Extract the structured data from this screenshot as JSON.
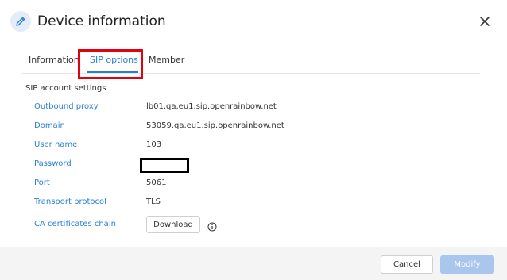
{
  "dialog": {
    "title": "Device information",
    "icon": "pencil-icon",
    "close_icon": "close-icon"
  },
  "tabs": [
    {
      "label": "Information",
      "active": false
    },
    {
      "label": "SIP options",
      "active": true
    },
    {
      "label": "Member",
      "active": false
    }
  ],
  "section": {
    "title": "SIP account settings",
    "rows": [
      {
        "label": "Outbound proxy",
        "value": "lb01.qa.eu1.sip.openrainbow.net"
      },
      {
        "label": "Domain",
        "value": "53059.qa.eu1.sip.openrainbow.net"
      },
      {
        "label": "User name",
        "value": "103"
      },
      {
        "label": "Password",
        "value": ""
      },
      {
        "label": "Port",
        "value": "5061"
      },
      {
        "label": "Transport protocol",
        "value": "TLS"
      },
      {
        "label": "CA certificates chain",
        "value": ""
      }
    ],
    "download_label": "Download",
    "info_icon": "info-icon"
  },
  "footer": {
    "cancel_label": "Cancel",
    "modify_label": "Modify"
  },
  "colors": {
    "accent": "#2a7fd4",
    "highlight": "#e3000f",
    "modify_disabled": "#a9c6ec"
  }
}
